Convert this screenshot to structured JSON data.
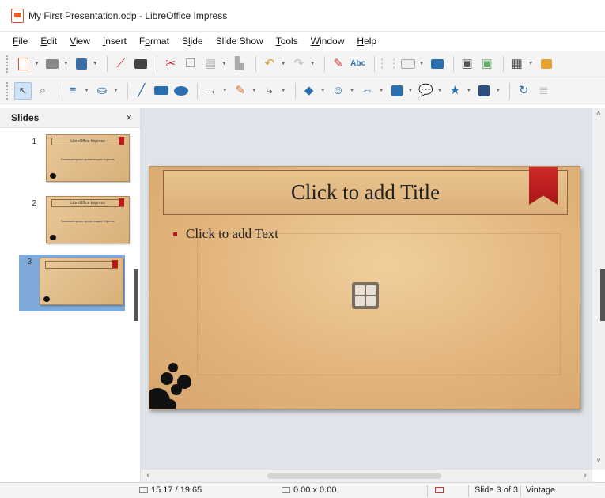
{
  "window": {
    "title": "My First Presentation.odp - LibreOffice Impress"
  },
  "menu": [
    {
      "label": "File",
      "u": "F",
      "rest": "ile"
    },
    {
      "label": "Edit",
      "u": "E",
      "rest": "dit"
    },
    {
      "label": "View",
      "u": "V",
      "rest": "iew"
    },
    {
      "label": "Insert",
      "u": "I",
      "rest": "nsert"
    },
    {
      "label": "Format",
      "u": "o",
      "pre": "F",
      "rest": "rmat"
    },
    {
      "label": "Slide",
      "u": "l",
      "pre": "S",
      "rest": "ide"
    },
    {
      "label": "Slide Show",
      "u": "",
      "pre": "Slide Show",
      "rest": ""
    },
    {
      "label": "Tools",
      "u": "T",
      "rest": "ools"
    },
    {
      "label": "Window",
      "u": "W",
      "rest": "indow"
    },
    {
      "label": "Help",
      "u": "H",
      "rest": "elp"
    }
  ],
  "slides_pane": {
    "title": "Slides",
    "close": "×"
  },
  "thumbnails": [
    {
      "number": "1",
      "title": "LibreOffice Impress",
      "subtitle": "Компьютерная презентация Impress"
    },
    {
      "number": "2",
      "title": "LibreOffice Impress",
      "subtitle": "Компьютерная презентация Impress"
    },
    {
      "number": "3",
      "title": "",
      "subtitle": ""
    }
  ],
  "slide": {
    "title_placeholder": "Click to add Title",
    "content_placeholder": "Click to add Text"
  },
  "status": {
    "position": "15.17 / 19.65",
    "size": "0.00 x 0.00",
    "slide_info": "Slide 3 of 3",
    "master": "Vintage"
  },
  "colors": {
    "ribbon": "#b61a1a",
    "slide_bg": "#e2b57c",
    "selection": "#7ea9d8"
  }
}
